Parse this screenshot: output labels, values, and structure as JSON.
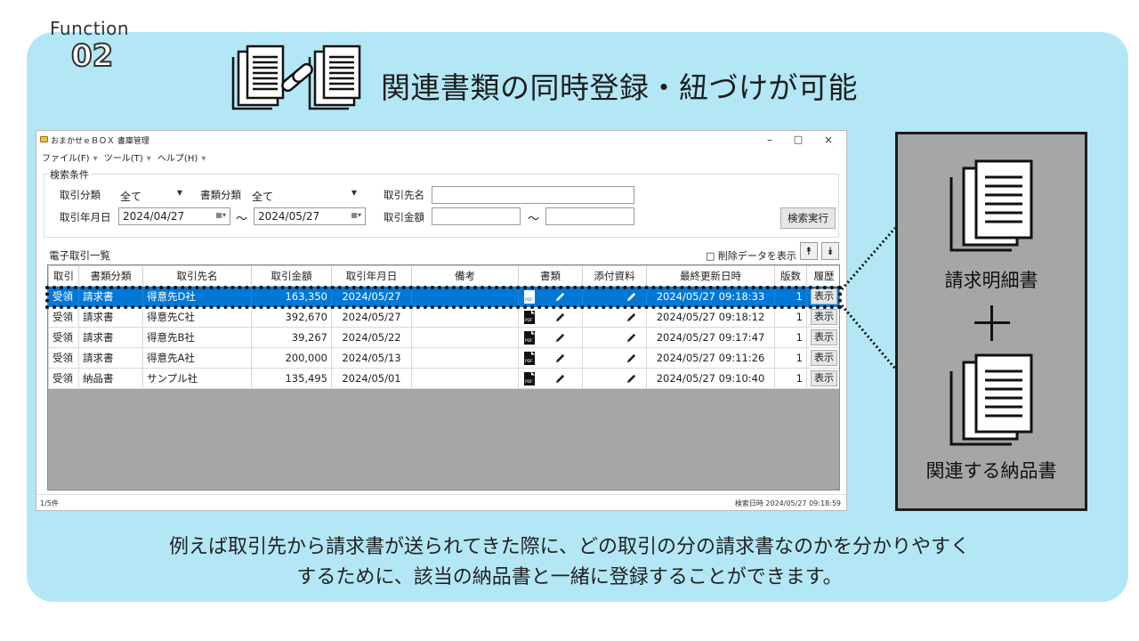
{
  "banner": {
    "function_label": "Function",
    "function_number": "02",
    "headline": "関連書類の同時登録・紐づけが可能",
    "caption_line1": "例えば取引先から請求書が送られてきた際に、どの取引の分の請求書なのかを分かりやすく",
    "caption_line2": "するために、該当の納品書と一緒に登録することができます。"
  },
  "window": {
    "title": "おまかせｅＢＯＸ 書庫管理",
    "controls": {
      "minimize": "–",
      "maximize": "□",
      "close": "×"
    },
    "menu": [
      "ファイル(F)",
      "ツール(T)",
      "ヘルプ(H)"
    ]
  },
  "search": {
    "group_title": "検索条件",
    "tx_type_label": "取引分類",
    "tx_type_value": "全て",
    "doc_type_label": "書類分類",
    "doc_type_value": "全て",
    "partner_label": "取引先名",
    "partner_value": "",
    "date_label": "取引年月日",
    "date_from": "2024/04/27",
    "date_to": "2024/05/27",
    "amount_label": "取引金額",
    "amount_from": "",
    "amount_to": "",
    "range_sep": "～",
    "search_button": "検索実行"
  },
  "list": {
    "title": "電子取引一覧",
    "show_deleted": "□ 削除データを表示",
    "sort_top": "⯭",
    "sort_bottom": "⯯",
    "columns": [
      "取引",
      "書類分類",
      "取引先名",
      "取引金額",
      "取引年月日",
      "備考",
      "書類",
      "添付資料",
      "最終更新日時",
      "版数",
      "履歴"
    ],
    "show_label": "表示",
    "pdf_label": "PDF",
    "rows": [
      {
        "type": "受領",
        "doc": "請求書",
        "partner": "得意先D社",
        "amount": "163,350",
        "date": "2024/05/27",
        "note": "",
        "updated": "2024/05/27 09:18:33",
        "version": "1",
        "selected": true
      },
      {
        "type": "受領",
        "doc": "請求書",
        "partner": "得意先C社",
        "amount": "392,670",
        "date": "2024/05/27",
        "note": "",
        "updated": "2024/05/27 09:18:12",
        "version": "1"
      },
      {
        "type": "受領",
        "doc": "請求書",
        "partner": "得意先B社",
        "amount": "39,267",
        "date": "2024/05/22",
        "note": "",
        "updated": "2024/05/27 09:17:47",
        "version": "1"
      },
      {
        "type": "受領",
        "doc": "請求書",
        "partner": "得意先A社",
        "amount": "200,000",
        "date": "2024/05/13",
        "note": "",
        "updated": "2024/05/27 09:11:26",
        "version": "1"
      },
      {
        "type": "受領",
        "doc": "納品書",
        "partner": "サンプル社",
        "amount": "135,495",
        "date": "2024/05/01",
        "note": "",
        "updated": "2024/05/27 09:10:40",
        "version": "1"
      }
    ]
  },
  "status": {
    "count": "1/5件",
    "search_time": "検索日時 2024/05/27 09:18:59"
  },
  "side": {
    "doc1_label": "請求明細書",
    "doc2_label": "関連する納品書"
  }
}
